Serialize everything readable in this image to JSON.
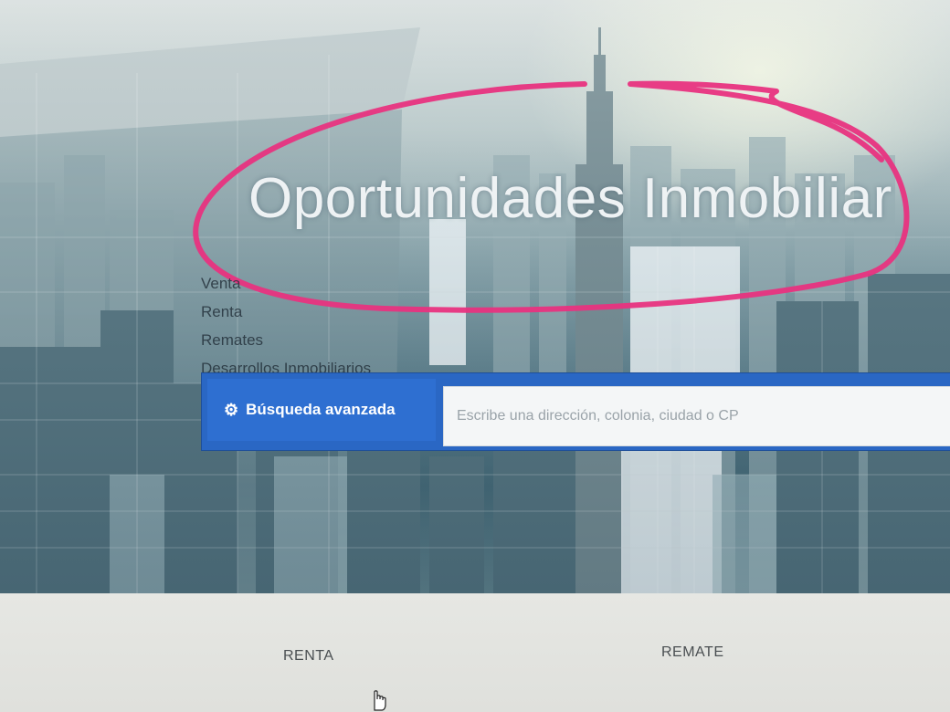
{
  "hero": {
    "title": "Oportunidades Inmobiliar"
  },
  "property_types": [
    {
      "label": "Venta"
    },
    {
      "label": "Renta"
    },
    {
      "label": "Remates"
    },
    {
      "label": "Desarrollos Inmobiliarios"
    }
  ],
  "search": {
    "advanced_label": "Búsqueda avanzada",
    "advanced_icon": "gear-icon",
    "placeholder": "Escribe una dirección, colonia, ciudad o CP"
  },
  "categories": [
    {
      "label": "RENTA"
    },
    {
      "label": "REMATE"
    }
  ],
  "colors": {
    "search_bar": "#2a67c4",
    "annotation_ink": "#e8337f",
    "title_text": "#eef2f4"
  }
}
